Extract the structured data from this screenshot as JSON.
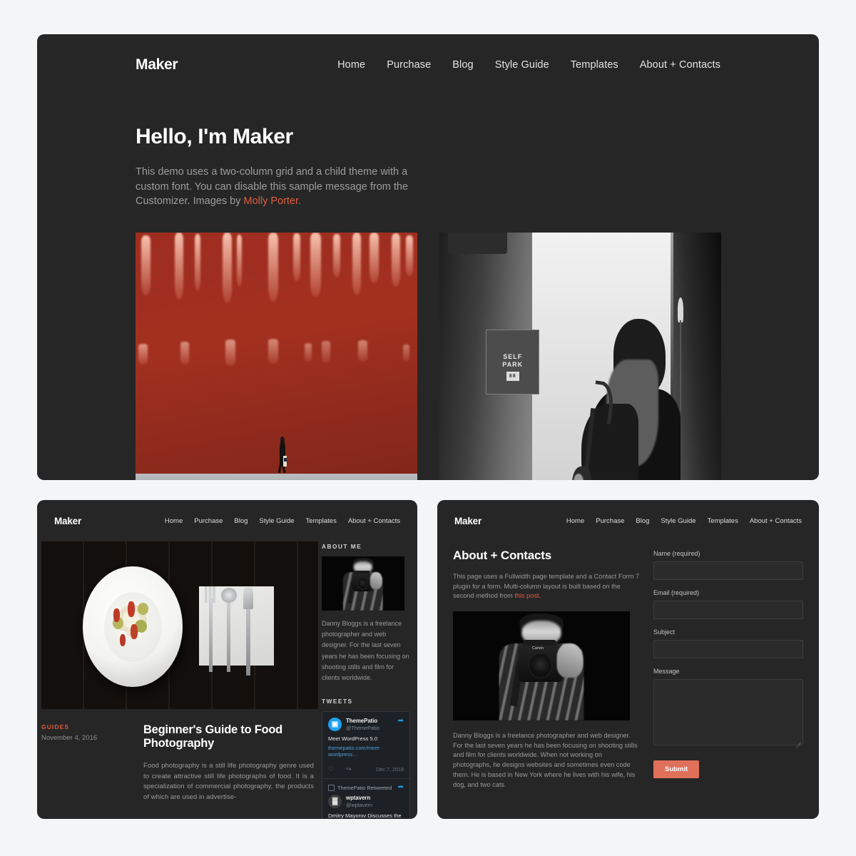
{
  "theme": {
    "page_bg": "#f4f5f7",
    "card_bg": "#262626",
    "accent": "#e05c3e",
    "button": "#e0705a"
  },
  "hero": {
    "brand": "Maker",
    "nav": [
      {
        "label": "Home"
      },
      {
        "label": "Purchase"
      },
      {
        "label": "Blog"
      },
      {
        "label": "Style Guide"
      },
      {
        "label": "Templates"
      },
      {
        "label": "About + Contacts"
      }
    ],
    "title": "Hello, I'm Maker",
    "description_part1": "This demo uses a two-column grid and a child theme with a custom font. You can disable this sample message from the Customizer. Images by ",
    "description_link": "Molly Porter.",
    "photos": [
      {
        "name": "red-wall-pedestrian",
        "alt": "Person walking past a red wall with light streaks"
      },
      {
        "name": "saxophone-street-musician",
        "alt": "Black and white photo of a saxophonist on the street"
      }
    ]
  },
  "blog_panel": {
    "brand": "Maker",
    "nav": [
      {
        "label": "Home"
      },
      {
        "label": "Purchase"
      },
      {
        "label": "Blog"
      },
      {
        "label": "Style Guide"
      },
      {
        "label": "Templates"
      },
      {
        "label": "About + Contacts"
      }
    ],
    "post": {
      "photo_alt": "Overhead shot of a plated meal with cutlery on dark wood",
      "category": "GUIDES",
      "date": "November 4, 2016",
      "title": "Beginner's Guide to Food Photography",
      "excerpt": "Food photography is a still life photography genre used to create attractive still life photographs of food. It is a specialization of commercial photography, the products of which are used in advertise-"
    },
    "about_widget": {
      "title": "ABOUT ME",
      "photo_alt": "Photographer holding a camera",
      "text": "Danny Bloggs is a freelance photographer and web designer. For the last seven years he has been focusing on shooting stills and film for clients worldwide."
    },
    "tweets_widget": {
      "title": "TWEETS",
      "tweets": [
        {
          "name": "ThemePatio",
          "handle": "@ThemePatio",
          "text": "Meet WordPress 5.0",
          "link": "themepatio.com/meet-wordpress…",
          "date": "Dec 7, 2018",
          "avatar_glyph": "▣",
          "like_icon": "♡",
          "share_icon": "↪"
        },
        {
          "retweet_label": "ThemePatio Retweeted",
          "name": "wptavern",
          "handle": "@wptavern",
          "text": "Dmitry Mayorov Discusses the Challenges of Organizing WordCamp Moscow and the Future of",
          "avatar_glyph": "▓"
        }
      ]
    }
  },
  "contact_panel": {
    "brand": "Maker",
    "nav": [
      {
        "label": "Home"
      },
      {
        "label": "Purchase"
      },
      {
        "label": "Blog"
      },
      {
        "label": "Style Guide"
      },
      {
        "label": "Templates"
      },
      {
        "label": "About + Contacts"
      }
    ],
    "title": "About + Contacts",
    "description_part1": "This page uses a Fullwidth page template and a Contact Form 7 plugin for a form. Multi-column layout is built based on the second method from ",
    "description_link": "this post.",
    "photo_alt": "Photographer holding a Canon DSLR camera",
    "bio": "Danny Bloggs is a freelance photographer and web designer. For the last seven years he has been focusing on shooting stills and film for clients worldwide. When not working on photographs, he designs websites and sometimes even code them. He is based in New York where he lives with his wife, his dog, and two cats.",
    "form": {
      "fields": [
        {
          "label": "Name (required)",
          "value": "",
          "type": "input"
        },
        {
          "label": "Email (required)",
          "value": "",
          "type": "input"
        },
        {
          "label": "Subject",
          "value": "",
          "type": "input"
        },
        {
          "label": "Message",
          "value": "",
          "type": "textarea"
        }
      ],
      "submit_label": "Submit"
    }
  }
}
